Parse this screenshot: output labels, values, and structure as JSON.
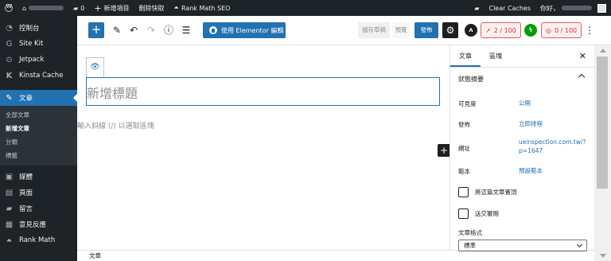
{
  "admin_bar": {
    "comments_count": "0",
    "new_post": "新增項目",
    "clear_cache_short": "刪除快取",
    "rank_math": "Rank Math SEO",
    "clear_caches": "Clear Caches",
    "greeting": "你好，"
  },
  "sidebar": {
    "items": [
      {
        "label": "控制台",
        "icon": "dashboard-icon"
      },
      {
        "label": "Site Kit",
        "icon": "google-icon"
      },
      {
        "label": "Jetpack",
        "icon": "jetpack-icon"
      },
      {
        "label": "Kinsta Cache",
        "icon": "kinsta-icon"
      },
      {
        "label": "文章",
        "icon": "pin-icon",
        "active": true
      }
    ],
    "submenu": [
      "全部文章",
      "新增文章",
      "分類",
      "標籤"
    ],
    "items_bottom": [
      {
        "label": "媒體",
        "icon": "media-icon"
      },
      {
        "label": "頁面",
        "icon": "page-icon"
      },
      {
        "label": "留言",
        "icon": "comment-icon"
      },
      {
        "label": "意見反應",
        "icon": "feedback-icon"
      },
      {
        "label": "Rank Math",
        "icon": "rankmath-icon"
      }
    ]
  },
  "toolbar": {
    "elementor_label": "使用 Elementor 編輯",
    "save_draft": "儲存草稿",
    "preview": "預覽",
    "publish": "發佈",
    "seo_score": "2 / 100",
    "readability_score": "0 / 100"
  },
  "editor": {
    "title_placeholder": "新增標題",
    "block_hint": "輸入斜線 (/) 以選取區塊"
  },
  "status_bar": {
    "label": "文章"
  },
  "panel": {
    "tabs": [
      "文章",
      "區塊"
    ],
    "section_title": "狀態摘要",
    "rows": [
      {
        "label": "可見度",
        "value": "公開"
      },
      {
        "label": "發佈",
        "value": "立即排程"
      },
      {
        "label": "網址",
        "value": "ueinspection.com.tw/?p=1647"
      },
      {
        "label": "範本",
        "value": "預設範本"
      }
    ],
    "sticky_label": "將這篇文章置頂",
    "pending_label": "送交審閱",
    "format_label": "文章格式",
    "format_value": "標準"
  },
  "colors": {
    "accent": "#2271b1",
    "admin_dark": "#1d2327",
    "score_red": "#d63638"
  }
}
